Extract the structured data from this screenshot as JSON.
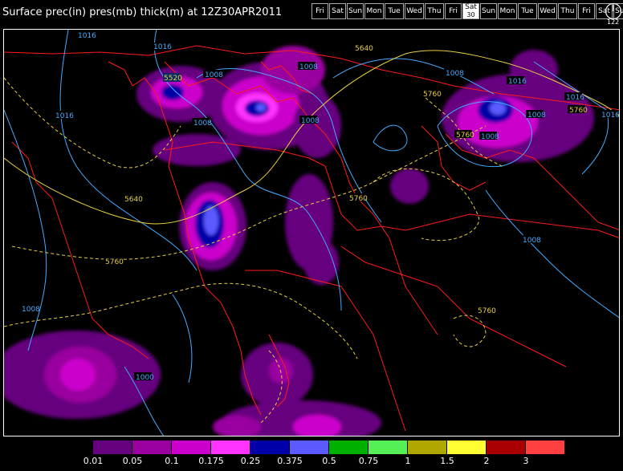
{
  "title": "Surface prec(in) pres(mb) thick(m) at 12Z30APR2011",
  "day_selector": [
    {
      "label": "Fri"
    },
    {
      "label": "Sat"
    },
    {
      "label": "Sun"
    },
    {
      "label": "Mon"
    },
    {
      "label": "Tue"
    },
    {
      "label": "Wed"
    },
    {
      "label": "Thu"
    },
    {
      "label": "Fri"
    },
    {
      "label": "Sat",
      "sub": "30",
      "selected": true
    },
    {
      "label": "Sun"
    },
    {
      "label": "Mon"
    },
    {
      "label": "Tue"
    },
    {
      "label": "Wed"
    },
    {
      "label": "Thu"
    },
    {
      "label": "Fri"
    },
    {
      "label": "Sat"
    },
    {
      "label": "Sun"
    }
  ],
  "clock_label": "122",
  "contour_labels": {
    "isobar_1016_a": "1016",
    "isobar_1016_b": "1016",
    "isobar_1016_c": "1016",
    "isobar_1016_d": "1016",
    "isobar_1016_e": "1016",
    "isobar_1008_a": "1008",
    "isobar_1008_b": "1008",
    "isobar_1008_c": "1008",
    "isobar_1008_d": "1008",
    "isobar_1008_e": "1008",
    "isobar_1008_f": "1008",
    "isobar_1008_g": "1008",
    "isobar_1008_h": "1008",
    "isobar_1000": "1000",
    "thick_5520": "5520",
    "thick_5640_a": "5640",
    "thick_5640_b": "5640",
    "thick_5760_a": "5760",
    "thick_5760_b": "5760",
    "thick_5760_c": "5760",
    "thick_5760_d": "5760",
    "thick_5760_e": "5760",
    "thick_5760_f": "5760"
  },
  "legend": {
    "colors": [
      "#000000",
      "#66007f",
      "#99009f",
      "#cc00cc",
      "#ff33ff",
      "#0000a8",
      "#5a5aff",
      "#00b000",
      "#55f055",
      "#b0a800",
      "#ffff33",
      "#a80000",
      "#ff4040"
    ],
    "ticks": [
      "0.01",
      "0.05",
      "0.1",
      "0.175",
      "0.25",
      "0.375",
      "0.5",
      "0.75",
      "1",
      "1.5",
      "2",
      "3"
    ]
  },
  "colors": {
    "isobar": "#44aaff",
    "thickness": "#e8d040",
    "border": "#ff1a1a"
  }
}
